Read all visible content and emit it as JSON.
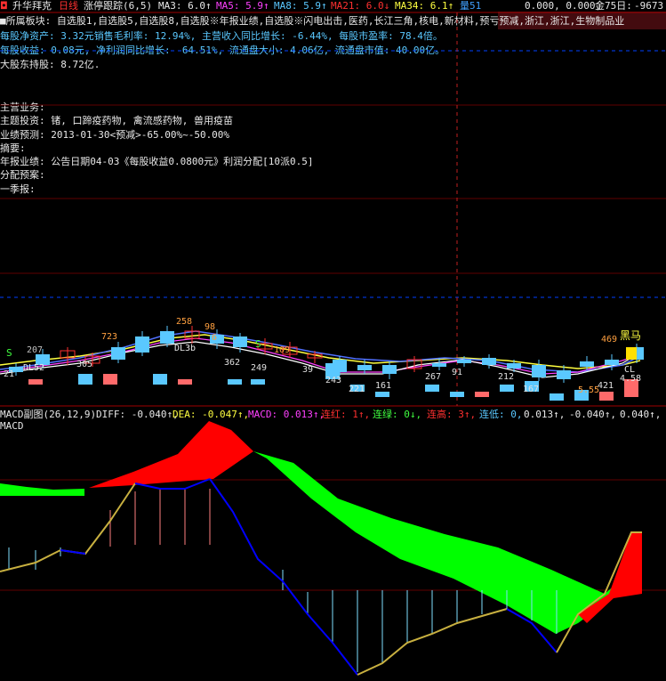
{
  "header": {
    "app_icon": "app-logo-icon",
    "stock_name": "升华拜克",
    "period": "日线",
    "indicator_name": "涨停跟踪(6,5)",
    "ma3": "MA3: 6.0↑",
    "ma5": "MA5: 5.9↑",
    "ma8": "MA8: 5.9↑",
    "ma21": "MA21: 6.0↓",
    "ma34": "MA34: 6.1↑",
    "vol_label": "量51",
    "misc_values": "0.000, 0.000,",
    "gold_label": "金75日:",
    "last_value": "-9673"
  },
  "info": {
    "sector": "■所属板块: 自选股1,自选股5,自选股8,自选股※年报业绩,自选股※闪电出击,医药,长江三角,核电,新材料,预亏预减,浙江,浙江,生物制品业",
    "eps_line": "每股净资产: 3.32元销售毛利率: 12.94%, 主营收入同比增长: -6.44%, 每股市盈率: 78.4倍。",
    "income_line": "每股收益: 0.08元, 净利润同比增长: -64.51%, 流通盘大小: 4.06亿, 流通盘市值: 40.00亿。",
    "holders_line": "大股东持股: 8.72亿.",
    "main_business": "主营业务:",
    "theme_invest": "主题投资: 锗, 口蹄疫药物, 禽流感药物, 兽用疫苗",
    "forecast": "业绩预测: 2013-01-30<预减>-65.00%~-50.00%",
    "summary": "摘要:",
    "annual_report": "年报业绩: 公告日期04-03《每股收益0.0800元》利润分配[10派0.5]",
    "dividend": "分配预案:",
    "q1_report": "一季报:"
  },
  "candles": {
    "labels_top": [
      "207",
      "723",
      "258",
      "98",
      "6",
      "109",
      "5.55",
      "469"
    ],
    "labels_bottom": [
      "21",
      "305",
      "362",
      "249",
      "39",
      "243",
      "221",
      "161",
      "267",
      "91",
      "212",
      "167",
      "421",
      "4.58"
    ],
    "signal_s": "S",
    "black_horse": "黑马",
    "small_tags": [
      "DL52",
      "DL3b",
      "CL",
      "S"
    ]
  },
  "macd": {
    "title": "MACD副图(26,12,9)",
    "diff": "DIFF: -0.040↑,",
    "dea": "DEA: -0.047↑,",
    "macd_val": "MACD: 0.013↑,",
    "lianhong": "连红: 1↑,",
    "lianlv": "连绿: 0↓,",
    "liangao": "连高: 3↑,",
    "liandi": "连低: 0,",
    "v1": "0.013↑,",
    "v2": "-0.040↑,",
    "v3": "0.040↑,",
    "sub_label": "MACD"
  },
  "colors": {
    "bg": "#000000",
    "up": "#ff3030",
    "down": "#5ac8ff",
    "ma_white": "#ffffff",
    "ma_yellow": "#ffff40",
    "ma_mag": "#ff40ff",
    "macd_green": "#00ff00",
    "macd_red": "#ff0000",
    "line_blue": "#0000ff",
    "line_olive": "#c8b040"
  }
}
